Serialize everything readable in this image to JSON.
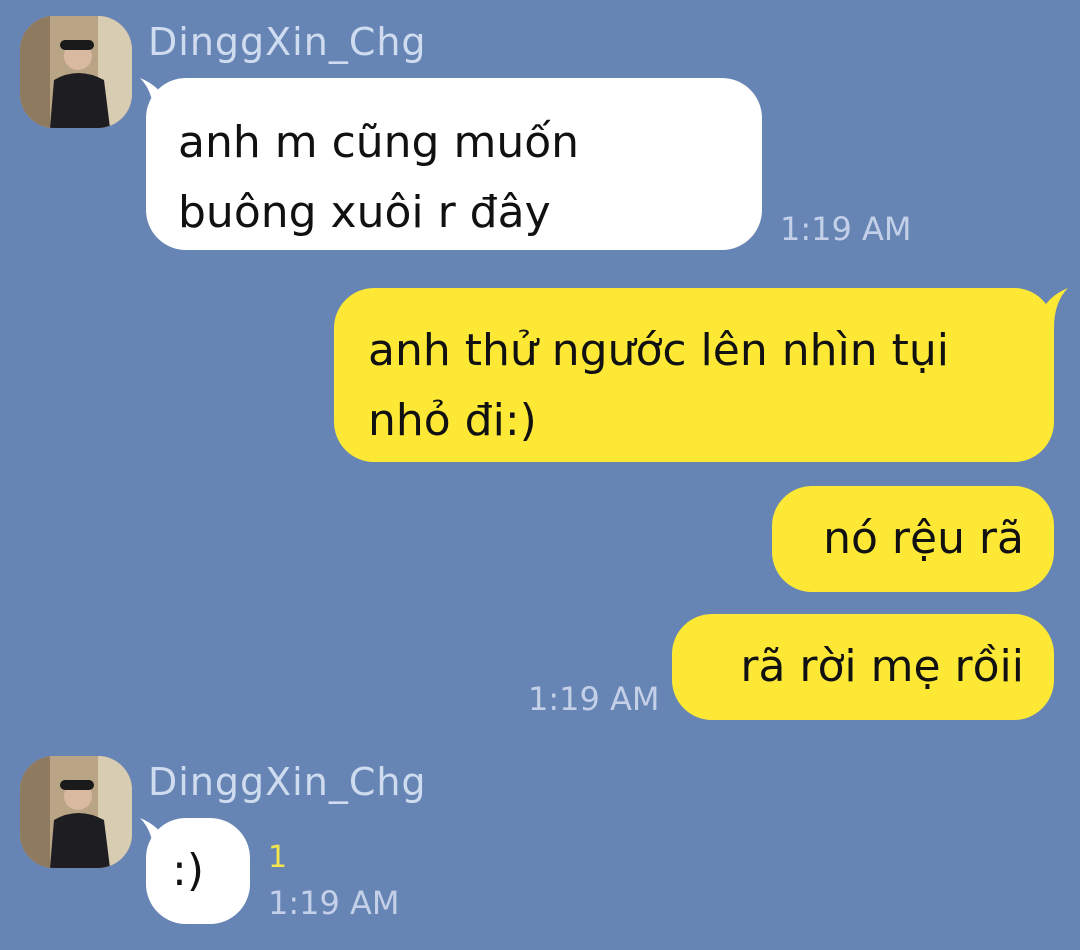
{
  "chat": {
    "sender_name": "DinggXin_Chg",
    "messages": [
      {
        "direction": "in",
        "lines": [
          "anh m cũng muốn",
          "buông xuôi r đây"
        ],
        "time": "1:19 AM"
      },
      {
        "direction": "out",
        "lines": [
          "anh thử ngước lên nhìn tụi",
          "nhỏ đi:)"
        ]
      },
      {
        "direction": "out",
        "lines": [
          "nó rệu rã"
        ]
      },
      {
        "direction": "out",
        "lines": [
          "rã rời mẹ rồii"
        ],
        "time": "1:19 AM"
      },
      {
        "direction": "in",
        "lines": [
          ":)"
        ],
        "read_count": "1",
        "time": "1:19 AM"
      }
    ]
  },
  "colors": {
    "background": "#6684b4",
    "incoming_bubble": "#ffffff",
    "outgoing_bubble": "#fde935",
    "sender_name": "#cfdcf0",
    "timestamp": "#c3d0e8",
    "read_count": "#f3e64a"
  },
  "icons": {
    "avatar": "avatar-photo"
  }
}
